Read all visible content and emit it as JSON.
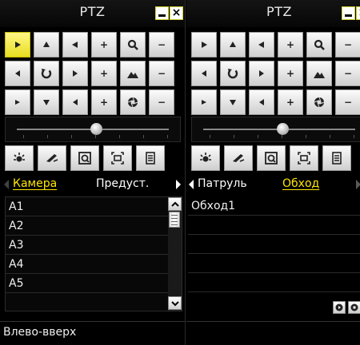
{
  "left_panel": {
    "title": "PTZ",
    "minimize_label": "",
    "close_label": "×",
    "tabs": {
      "camera": "Камера",
      "preset": "Предуст."
    },
    "list_items": [
      "A1",
      "A2",
      "A3",
      "A4",
      "A5"
    ],
    "status_text": "Влево-вверх"
  },
  "right_panel": {
    "title": "PTZ",
    "close_label": "×",
    "tabs": {
      "patrol": "Патруль",
      "tour": "Обход"
    },
    "list_items": [
      "Обход1"
    ]
  },
  "ptz_buttons": {
    "plus": "+",
    "minus": "−"
  },
  "colors": {
    "selected": "#ffe600",
    "button_light": "#f5f5f5",
    "background": "#000000"
  },
  "icons": {
    "direction_pad": [
      "arrow-up-left-icon",
      "arrow-up-icon",
      "arrow-up-right-icon",
      "arrow-left-icon",
      "auto-rotate-icon",
      "arrow-right-icon",
      "arrow-down-left-icon",
      "arrow-down-icon",
      "arrow-down-right-icon"
    ],
    "function_rows": [
      "zoom-icon",
      "focus-icon",
      "iris-icon"
    ],
    "toolbar": [
      "light-icon",
      "wiper-icon",
      "one-touch-focus-icon",
      "lens-init-icon",
      "menu-icon"
    ]
  }
}
